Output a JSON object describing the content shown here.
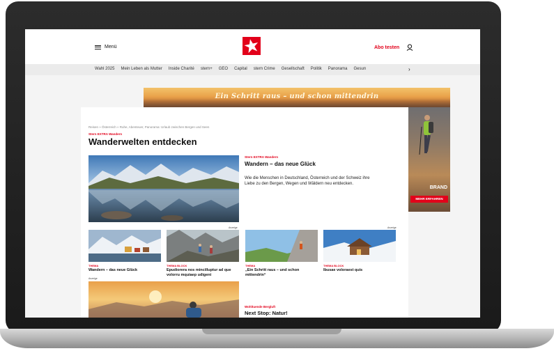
{
  "header": {
    "menu_label": "Menü",
    "abo_label": "Abo testen"
  },
  "nav": {
    "items": [
      "Wahl 2025",
      "Mein Leben als Mutter",
      "Inside Charité",
      "stern+",
      "GEO",
      "Capital",
      "stern Crime",
      "Gesellschaft",
      "Politik",
      "Panorama",
      "Gesun"
    ]
  },
  "banner": {
    "text": "Ein Schritt raus – und schon mittendrin"
  },
  "skyscraper": {
    "brand": "BRAND",
    "cta": "MEHR ERFAHREN"
  },
  "page": {
    "breadcrumb": "Reisen » Österreich » Ruhe, Abenteuer, Panorama: Urlaub zwischen Bergen und Seen",
    "kicker": "Stern EXTRA Wandern",
    "title": "Wanderwelten entdecken"
  },
  "hero": {
    "kicker": "Stern EXTRA Wandern",
    "title": "Wandern – das neue Glück",
    "teaser": "Wie die Menschen in Deutschland, Österreich und der Schweiz ihre Liebe zu den Bergen, Wegen und Wäldern neu entdecken."
  },
  "ad_label": "Anzeige",
  "cards": [
    {
      "kicker": "THEMA",
      "title": "Wandern – das neue Glück"
    },
    {
      "kicker": "THEMA BLOCK",
      "title": "Epudiorera nos mincilluptur ad que volorru mquiaep udigeni"
    },
    {
      "kicker": "THEMA",
      "title": "„Ein Schritt raus – und schon mittendrin“"
    },
    {
      "kicker": "THEMA BLOCK",
      "title": "Ibusae voloraest quis"
    }
  ],
  "bottom": {
    "kicker": "Wohltuende Bergluft",
    "title": "Next Stop: Natur!"
  },
  "colors": {
    "brand_red": "#e2001a",
    "nav_bg": "#ebebeb"
  }
}
